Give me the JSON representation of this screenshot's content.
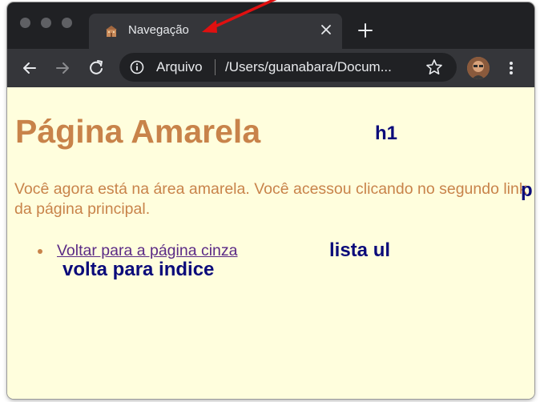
{
  "browser": {
    "tab": {
      "title": "Navegação"
    },
    "toolbar": {
      "origin_chip": "Arquivo",
      "url": "/Users/guanabara/Docum..."
    }
  },
  "page": {
    "h1": "Página Amarela",
    "paragraph": "Você agora está na área amarela. Você acessou clicando no segundo link da página principal.",
    "list_items": [
      {
        "label": "Voltar para a página cinza"
      }
    ]
  },
  "annotations": {
    "h1": "h1",
    "p": "p",
    "ul": "lista ul",
    "link": "volta para indice"
  },
  "colors": {
    "page_bg": "#fffedd",
    "heading": "#c8834a",
    "link": "#5b2a86",
    "annotation": "#0b0b7a",
    "arrow": "#e01010"
  },
  "icons": [
    "favicon-icon",
    "close-icon",
    "plus-icon",
    "back-icon",
    "forward-icon",
    "reload-icon",
    "info-icon",
    "star-icon",
    "menu-icon"
  ]
}
